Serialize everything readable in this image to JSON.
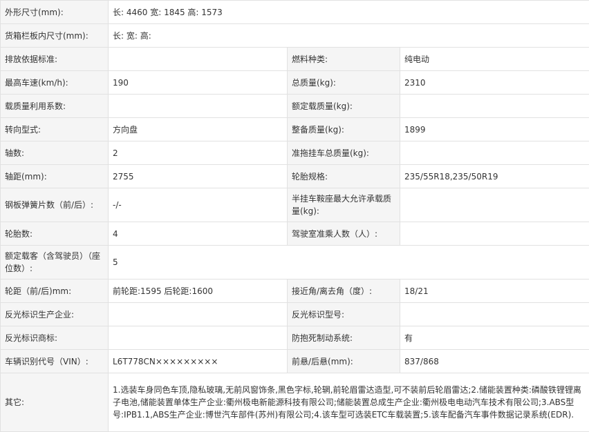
{
  "rows": [
    {
      "l1": "外形尺寸(mm):",
      "v1": "长: 4460 宽: 1845 高: 1573"
    },
    {
      "l1": "货箱栏板内尺寸(mm):",
      "v1": "长:  宽:  高:"
    },
    {
      "l1": "排放依据标准:",
      "v1": "",
      "l2": "燃料种类:",
      "v2": "纯电动"
    },
    {
      "l1": "最高车速(km/h):",
      "v1": "190",
      "l2": "总质量(kg):",
      "v2": "2310"
    },
    {
      "l1": "载质量利用系数:",
      "v1": "",
      "l2": "额定载质量(kg):",
      "v2": ""
    },
    {
      "l1": "转向型式:",
      "v1": "方向盘",
      "l2": "整备质量(kg):",
      "v2": "1899"
    },
    {
      "l1": "轴数:",
      "v1": "2",
      "l2": "准拖挂车总质量(kg):",
      "v2": ""
    },
    {
      "l1": "轴距(mm):",
      "v1": "2755",
      "l2": "轮胎规格:",
      "v2": "235/55R18,235/50R19"
    },
    {
      "l1": "钢板弹簧片数（前/后）:",
      "v1": "-/-",
      "l2": "半挂车鞍座最大允许承载质量(kg):",
      "v2": ""
    },
    {
      "l1": "轮胎数:",
      "v1": "4",
      "l2": "驾驶室准乘人数（人）:",
      "v2": ""
    },
    {
      "l1": "额定载客（含驾驶员）（座位数）:",
      "v1": "5"
    },
    {
      "l1": "轮距（前/后)mm:",
      "v1": "前轮距:1595 后轮距:1600",
      "l2": "接近角/离去角（度）:",
      "v2": "18/21"
    },
    {
      "l1": "反光标识生产企业:",
      "v1": "",
      "l2": "反光标识型号:",
      "v2": ""
    },
    {
      "l1": "反光标识商标:",
      "v1": "",
      "l2": "防抱死制动系统:",
      "v2": "有"
    },
    {
      "l1": "车辆识别代号（VIN）:",
      "v1": "L6T778CN×××××××××",
      "l2": "前悬/后悬(mm):",
      "v2": "837/868"
    },
    {
      "l1": "其它:",
      "v1": "1.选装车身同色车顶,隐私玻璃,无前风窗饰条,黑色字标,轮辋,前轮眉雷达造型,可不装前后轮眉雷达;2.储能装置种类:磷酸铁锂锂离子电池,储能装置单体生产企业:衢州极电新能源科技有限公司;储能装置总成生产企业:衢州极电电动汽车技术有限公司;3.ABS型号:IPB1.1,ABS生产企业:博世汽车部件(苏州)有限公司;4.该车型可选装ETC车载装置;5.该车配备汽车事件数据记录系统(EDR)."
    }
  ]
}
